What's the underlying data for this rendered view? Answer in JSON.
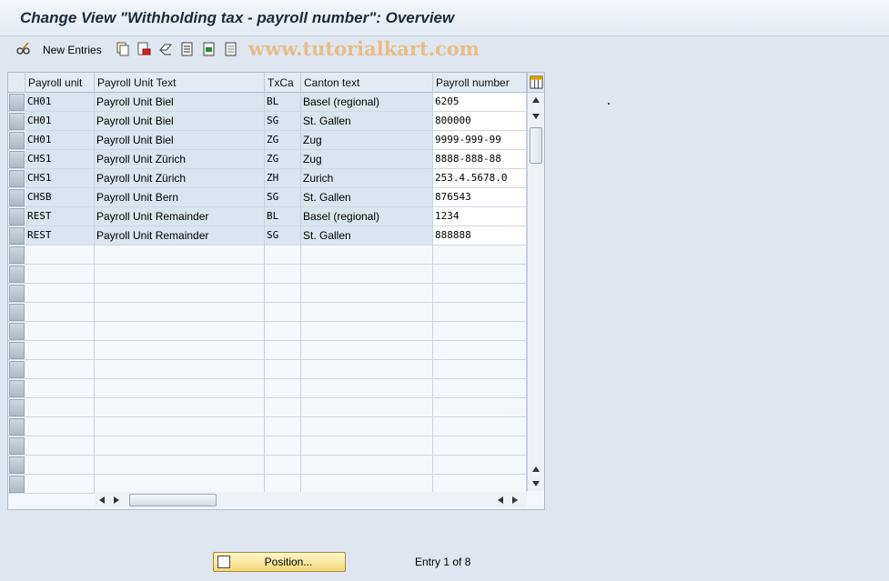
{
  "window": {
    "title": "Change View \"Withholding tax - payroll number\": Overview"
  },
  "toolbar": {
    "new_entries_label": "New Entries",
    "watermark": "www.tutorialkart.com",
    "icons": [
      "edit-glasses-icon",
      "copy-icon",
      "delete-icon",
      "undo-icon",
      "select-all-icon",
      "select-block-icon",
      "deselect-all-icon"
    ]
  },
  "table": {
    "columns": [
      "Payroll unit",
      "Payroll Unit Text",
      "TxCa",
      "Canton text",
      "Payroll number"
    ],
    "rows": [
      [
        "CH01",
        "Payroll Unit Biel",
        "BL",
        "Basel (regional)",
        "6205"
      ],
      [
        "CH01",
        "Payroll Unit Biel",
        "SG",
        "St. Gallen",
        "800000"
      ],
      [
        "CH01",
        "Payroll Unit Biel",
        "ZG",
        "Zug",
        "9999-999-99"
      ],
      [
        "CHS1",
        "Payroll Unit Zürich",
        "ZG",
        "Zug",
        "8888-888-88"
      ],
      [
        "CHS1",
        "Payroll Unit Zürich",
        "ZH",
        "Zurich",
        "253.4.5678.0"
      ],
      [
        "CHSB",
        "Payroll Unit Bern",
        "SG",
        "St. Gallen",
        "876543"
      ],
      [
        "REST",
        "Payroll Unit Remainder",
        "BL",
        "Basel (regional)",
        "1234"
      ],
      [
        "REST",
        "Payroll Unit Remainder",
        "SG",
        "St. Gallen",
        "888888"
      ]
    ]
  },
  "footer": {
    "position_button_label": "Position...",
    "entry_info": "Entry 1 of 8"
  },
  "colors": {
    "accent_button": "#f3d97a",
    "row_fill": "#dae5ef",
    "background": "#dfe6ef"
  }
}
